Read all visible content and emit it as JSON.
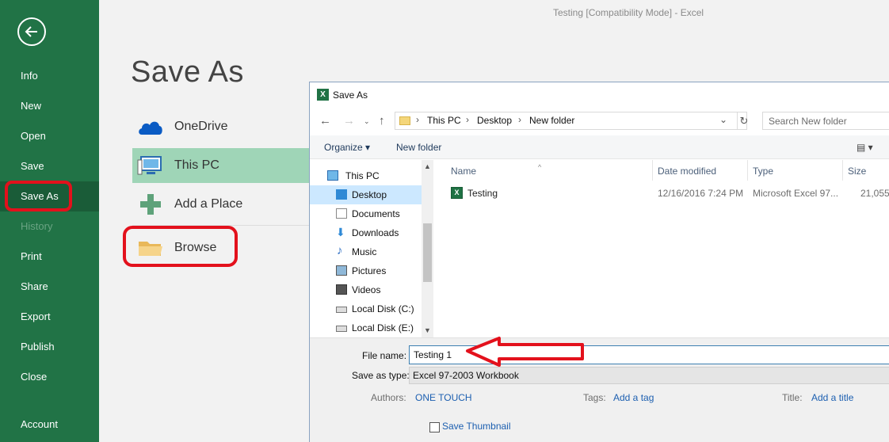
{
  "window_title": "Testing  [Compatibility Mode]  -  Excel",
  "backstage": {
    "page_title": "Save As",
    "nav": [
      {
        "label": "Info"
      },
      {
        "label": "New"
      },
      {
        "label": "Open"
      },
      {
        "label": "Save"
      },
      {
        "label": "Save As"
      },
      {
        "label": "History"
      },
      {
        "label": "Print"
      },
      {
        "label": "Share"
      },
      {
        "label": "Export"
      },
      {
        "label": "Publish"
      },
      {
        "label": "Close"
      },
      {
        "label": "Account"
      }
    ],
    "locations": [
      {
        "label": "OneDrive",
        "icon": "cloud-icon"
      },
      {
        "label": "This PC",
        "icon": "computer-icon"
      },
      {
        "label": "Add a Place",
        "icon": "plus-icon"
      },
      {
        "label": "Browse",
        "icon": "folder-icon"
      }
    ],
    "colors": {
      "sidebar": "#217346",
      "selected_location": "#9fd5b7",
      "annotation": "#e3111c"
    }
  },
  "dialog": {
    "title": "Save As",
    "breadcrumb": [
      "This PC",
      "Desktop",
      "New folder"
    ],
    "search_placeholder": "Search New folder",
    "toolbar": {
      "organize": "Organize ▾",
      "new_folder": "New folder"
    },
    "nav_pane": [
      "This PC",
      "Desktop",
      "Documents",
      "Downloads",
      "Music",
      "Pictures",
      "Videos",
      "Local Disk (C:)",
      "Local Disk (E:)"
    ],
    "columns": [
      "Name",
      "Date modified",
      "Type",
      "Size"
    ],
    "files": [
      {
        "name": "Testing",
        "date": "12/16/2016 7:24 PM",
        "type": "Microsoft Excel 97...",
        "size": "21,055"
      }
    ],
    "file_name_label": "File name:",
    "file_name_value": "Testing 1",
    "save_type_label": "Save as type:",
    "save_type_value": "Excel 97-2003 Workbook",
    "authors_label": "Authors:",
    "authors_value": "ONE TOUCH",
    "tags_label": "Tags:",
    "tags_value": "Add a tag",
    "title_label": "Title:",
    "title_value": "Add a title",
    "thumbnail_label": "Save Thumbnail"
  }
}
